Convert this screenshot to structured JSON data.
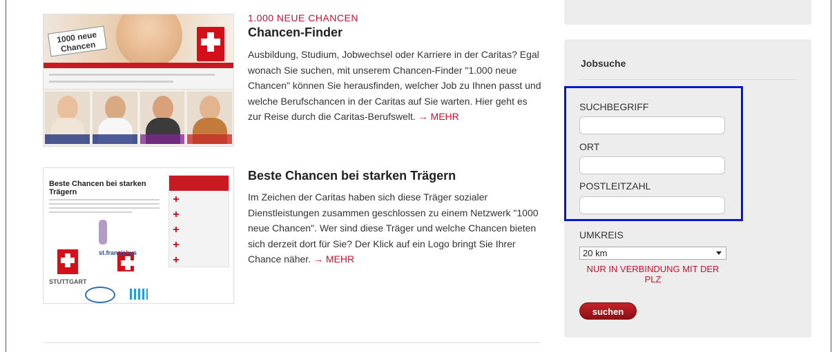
{
  "article1": {
    "kicker": "1.000 NEUE CHANCEN",
    "title": "Chancen-Finder",
    "body": "Ausbildung, Studium, Jobwechsel oder Karriere in der Caritas? Egal wonach Sie suchen, mit unserem Chancen-Finder \"1.000 neue Chancen\" können Sie herausfinden, welcher Job zu Ihnen passt und welche Berufschancen in der Caritas auf Sie warten. Hier geht es zur Reise durch die Caritas-Berufswelt.",
    "more": "→ MEHR",
    "thumb": {
      "sign_text": "1000 neue Chancen"
    }
  },
  "article2": {
    "title": "Beste Chancen bei starken Trägern",
    "body": "Im Zeichen der Caritas haben sich diese Träger sozialer Dienstleistungen zusammen geschlossen zu einem Netzwerk \"1000 neue Chancen\". Wer sind diese Träger und welche Chancen bieten sich derzeit dort für Sie? Der Klick auf ein Logo bringt Sie Ihrer Chance näher.",
    "more": "→ MEHR",
    "thumb": {
      "heading": "Beste Chancen bei starken Trägern",
      "logo_stuttgart": "STUTTGART",
      "logo_franziskus": "st.franziskus"
    }
  },
  "jobsuche": {
    "title": "Jobsuche",
    "suchbegriff_label": "SUCHBEGRIFF",
    "ort_label": "ORT",
    "plz_label": "POSTLEITZAHL",
    "umkreis_label": "UMKREIS",
    "umkreis_value": "20 km",
    "note": "NUR IN VERBINDUNG MIT DER PLZ",
    "button": "suchen"
  }
}
